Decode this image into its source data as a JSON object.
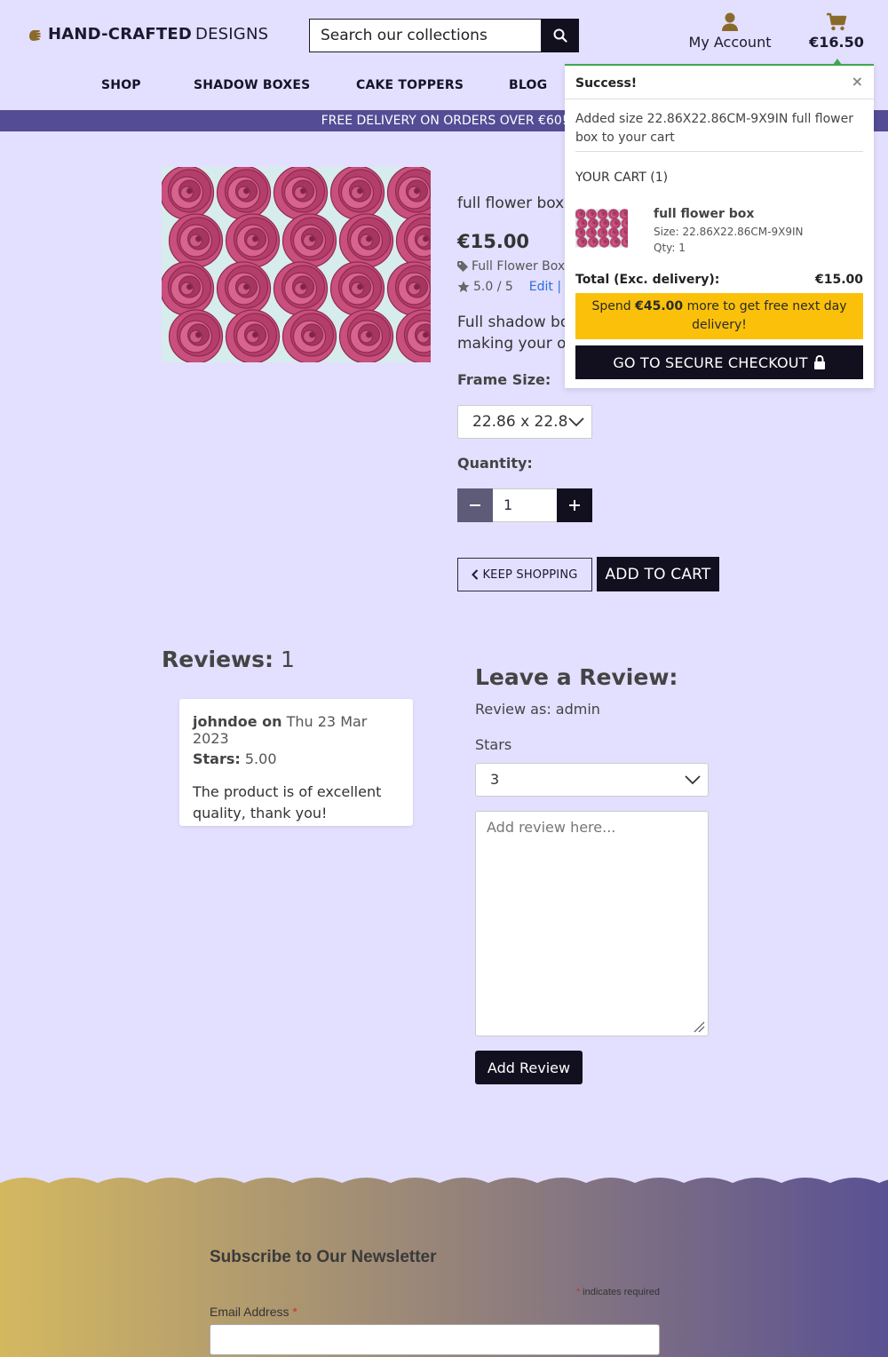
{
  "header": {
    "logo_bold": "HAND-CRAFTED",
    "logo_thin": "DESIGNS",
    "search_placeholder": "Search our collections",
    "account_label": "My Account",
    "cart_total": "€16.50"
  },
  "nav": {
    "items": [
      "SHOP",
      "SHADOW BOXES",
      "CAKE TOPPERS",
      "BLOG"
    ]
  },
  "banner": {
    "text": "FREE DELIVERY ON ORDERS OVER €60!"
  },
  "product": {
    "title": "full flower box",
    "price": "€15.00",
    "tag": "Full Flower Box",
    "rating": "5.0 / 5",
    "edit_link": "Edit |",
    "description": "Full shadow box making your ov",
    "desc_line1": "Full shadow bo",
    "desc_line2": "making your ov",
    "frame_size_label": "Frame Size:",
    "frame_size_value": "22.86 x 22.8",
    "quantity_label": "Quantity:",
    "quantity_value": "1",
    "keep_shopping": "KEEP SHOPPING",
    "add_to_cart": "ADD TO CART"
  },
  "reviews": {
    "heading": "Reviews:",
    "count": "1",
    "items": [
      {
        "author": "johndoe on",
        "date": "Thu 23 Mar 2023",
        "stars_label": "Stars:",
        "stars_value": "5.00",
        "text": "The product is of excellent quality, thank you!"
      }
    ]
  },
  "leave_review": {
    "heading": "Leave a Review:",
    "review_as": "Review as: admin",
    "stars_label": "Stars",
    "stars_value": "3",
    "textarea_placeholder": "Add review here...",
    "submit": "Add Review"
  },
  "newsletter": {
    "title": "Subscribe to Our Newsletter",
    "required_star": "*",
    "required_note": "indicates required",
    "email_label": "Email Address"
  },
  "cart_popup": {
    "title": "Success!",
    "close": "×",
    "message": "Added size 22.86X22.86CM-9X9IN full flower box to your cart",
    "your_cart": "YOUR CART (1)",
    "item_name": "full flower box",
    "item_size": "Size: 22.86X22.86CM-9X9IN",
    "item_qty": "Qty: 1",
    "total_label": "Total (Exc. delivery):",
    "total_value": "€15.00",
    "spend_pre": "Spend",
    "spend_amount": "€45.00",
    "spend_post": "more to get free next day delivery!",
    "checkout": "GO TO SECURE CHECKOUT"
  },
  "colors": {
    "page_bg": "#e3dfff",
    "banner_bg": "#544c95",
    "dark_button": "#12101f",
    "popup_success": "#3ea74c",
    "spend_bg": "#fbc10a",
    "link": "#2a6ed8",
    "footer_gradient_start": "#d4b860",
    "footer_gradient_end": "#544c95"
  },
  "icons": [
    "hand-logo-icon",
    "search-icon",
    "user-icon",
    "cart-icon",
    "tag-icon",
    "star-icon",
    "chevron-down-icon",
    "minus-icon",
    "plus-icon",
    "chevron-left-icon",
    "lock-icon",
    "close-icon",
    "resize-grip-icon"
  ]
}
